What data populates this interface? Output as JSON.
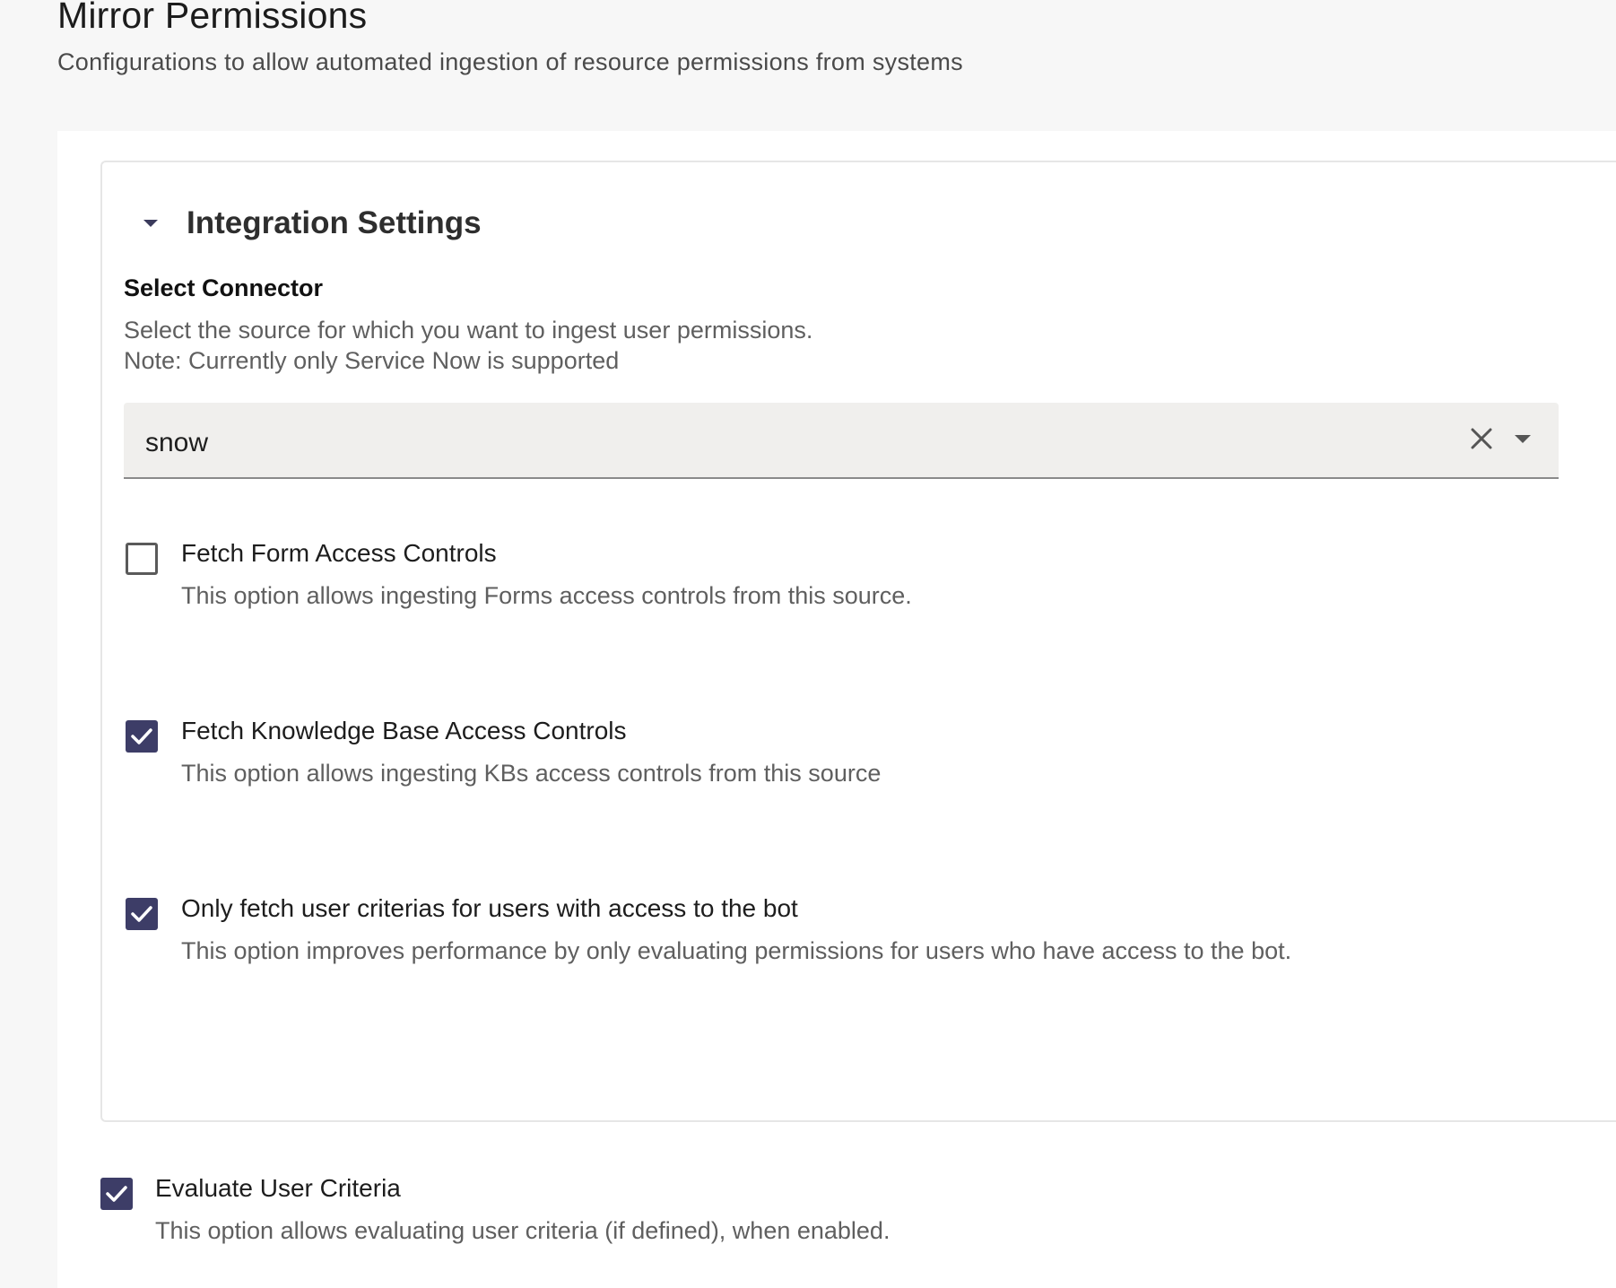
{
  "header": {
    "title": "Mirror Permissions",
    "subtitle": "Configurations to allow automated ingestion of resource permissions from systems"
  },
  "integration_settings": {
    "title": "Integration Settings",
    "expanded": true,
    "connector": {
      "label": "Select Connector",
      "description_line1": "Select the source for which you want to ingest user permissions.",
      "description_line2": "Note: Currently only Service Now is supported",
      "selected_value": "snow"
    },
    "options": [
      {
        "label": "Fetch Form Access Controls",
        "description": "This option allows ingesting Forms access controls from this source.",
        "checked": false
      },
      {
        "label": "Fetch Knowledge Base Access Controls",
        "description": "This option allows ingesting KBs access controls from this source",
        "checked": true
      },
      {
        "label": "Only fetch user criterias for users with access to the bot",
        "description": "This option improves performance by only evaluating permissions for users who have access to the bot.",
        "checked": true
      }
    ]
  },
  "evaluate_user_criteria": {
    "label": "Evaluate User Criteria",
    "description": "This option allows evaluating user criteria (if defined), when enabled.",
    "checked": true
  },
  "colors": {
    "checkbox_checked": "#3d3d67",
    "select_background": "#f0efed",
    "page_background": "#f7f7f7"
  }
}
